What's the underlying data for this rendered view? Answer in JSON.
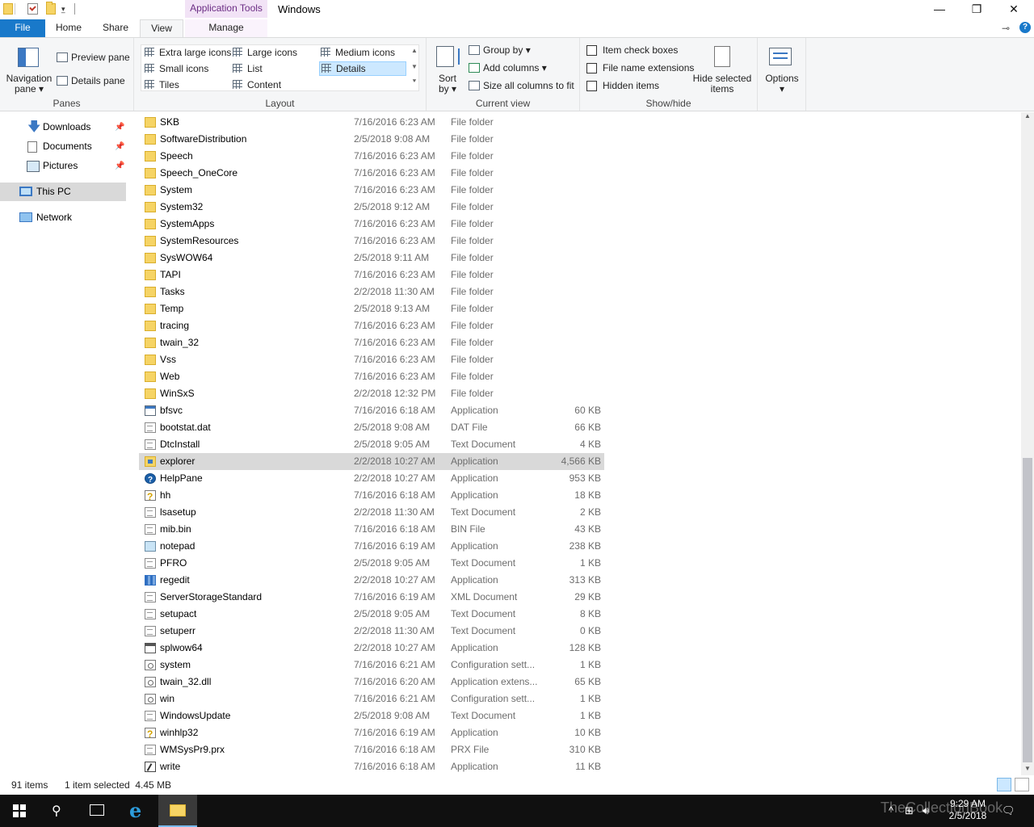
{
  "titlebar": {
    "contextual_tab": "Application Tools",
    "window_title": "Windows",
    "minimize": "—",
    "maximize": "❐",
    "close": "✕"
  },
  "ribbon_tabs": {
    "file": "File",
    "home": "Home",
    "share": "Share",
    "view": "View",
    "manage": "Manage"
  },
  "ribbon": {
    "panes": {
      "label": "Panes",
      "navigation_pane": "Navigation pane",
      "preview_pane": "Preview pane",
      "details_pane": "Details pane"
    },
    "layout": {
      "label": "Layout",
      "items": [
        "Extra large icons",
        "Large icons",
        "Medium icons",
        "Small icons",
        "List",
        "Details",
        "Tiles",
        "Content"
      ],
      "selected": "Details"
    },
    "current_view": {
      "label": "Current view",
      "sort_by": "Sort by",
      "group_by": "Group by",
      "add_columns": "Add columns",
      "size_columns": "Size all columns to fit"
    },
    "show_hide": {
      "label": "Show/hide",
      "item_check_boxes": "Item check boxes",
      "file_name_extensions": "File name extensions",
      "hidden_items": "Hidden items",
      "hide_selected": "Hide selected items"
    },
    "options": "Options"
  },
  "nav": {
    "items": [
      {
        "label": "Downloads",
        "pinned": true
      },
      {
        "label": "Documents",
        "pinned": true
      },
      {
        "label": "Pictures",
        "pinned": true
      },
      {
        "label": "This PC",
        "pinned": false
      },
      {
        "label": "Network",
        "pinned": false
      }
    ],
    "selected": "This PC"
  },
  "files": [
    {
      "name": "SKB",
      "date": "7/16/2016 6:23 AM",
      "type": "File folder",
      "size": "",
      "icon": "folder"
    },
    {
      "name": "SoftwareDistribution",
      "date": "2/5/2018 9:08 AM",
      "type": "File folder",
      "size": "",
      "icon": "folder"
    },
    {
      "name": "Speech",
      "date": "7/16/2016 6:23 AM",
      "type": "File folder",
      "size": "",
      "icon": "folder"
    },
    {
      "name": "Speech_OneCore",
      "date": "7/16/2016 6:23 AM",
      "type": "File folder",
      "size": "",
      "icon": "folder"
    },
    {
      "name": "System",
      "date": "7/16/2016 6:23 AM",
      "type": "File folder",
      "size": "",
      "icon": "folder"
    },
    {
      "name": "System32",
      "date": "2/5/2018 9:12 AM",
      "type": "File folder",
      "size": "",
      "icon": "folder"
    },
    {
      "name": "SystemApps",
      "date": "7/16/2016 6:23 AM",
      "type": "File folder",
      "size": "",
      "icon": "folder"
    },
    {
      "name": "SystemResources",
      "date": "7/16/2016 6:23 AM",
      "type": "File folder",
      "size": "",
      "icon": "folder"
    },
    {
      "name": "SysWOW64",
      "date": "2/5/2018 9:11 AM",
      "type": "File folder",
      "size": "",
      "icon": "folder"
    },
    {
      "name": "TAPI",
      "date": "7/16/2016 6:23 AM",
      "type": "File folder",
      "size": "",
      "icon": "folder"
    },
    {
      "name": "Tasks",
      "date": "2/2/2018 11:30 AM",
      "type": "File folder",
      "size": "",
      "icon": "folder"
    },
    {
      "name": "Temp",
      "date": "2/5/2018 9:13 AM",
      "type": "File folder",
      "size": "",
      "icon": "folder"
    },
    {
      "name": "tracing",
      "date": "7/16/2016 6:23 AM",
      "type": "File folder",
      "size": "",
      "icon": "folder"
    },
    {
      "name": "twain_32",
      "date": "7/16/2016 6:23 AM",
      "type": "File folder",
      "size": "",
      "icon": "folder"
    },
    {
      "name": "Vss",
      "date": "7/16/2016 6:23 AM",
      "type": "File folder",
      "size": "",
      "icon": "folder"
    },
    {
      "name": "Web",
      "date": "7/16/2016 6:23 AM",
      "type": "File folder",
      "size": "",
      "icon": "folder"
    },
    {
      "name": "WinSxS",
      "date": "2/2/2018 12:32 PM",
      "type": "File folder",
      "size": "",
      "icon": "folder"
    },
    {
      "name": "bfsvc",
      "date": "7/16/2016 6:18 AM",
      "type": "Application",
      "size": "60 KB",
      "icon": "app"
    },
    {
      "name": "bootstat.dat",
      "date": "2/5/2018 9:08 AM",
      "type": "DAT File",
      "size": "66 KB",
      "icon": "doc"
    },
    {
      "name": "DtcInstall",
      "date": "2/5/2018 9:05 AM",
      "type": "Text Document",
      "size": "4 KB",
      "icon": "doc"
    },
    {
      "name": "explorer",
      "date": "2/2/2018 10:27 AM",
      "type": "Application",
      "size": "4,566 KB",
      "icon": "explorer"
    },
    {
      "name": "HelpPane",
      "date": "2/2/2018 10:27 AM",
      "type": "Application",
      "size": "953 KB",
      "icon": "help"
    },
    {
      "name": "hh",
      "date": "7/16/2016 6:18 AM",
      "type": "Application",
      "size": "18 KB",
      "icon": "qhelp"
    },
    {
      "name": "lsasetup",
      "date": "2/2/2018 11:30 AM",
      "type": "Text Document",
      "size": "2 KB",
      "icon": "doc"
    },
    {
      "name": "mib.bin",
      "date": "7/16/2016 6:18 AM",
      "type": "BIN File",
      "size": "43 KB",
      "icon": "doc"
    },
    {
      "name": "notepad",
      "date": "7/16/2016 6:19 AM",
      "type": "Application",
      "size": "238 KB",
      "icon": "notepad"
    },
    {
      "name": "PFRO",
      "date": "2/5/2018 9:05 AM",
      "type": "Text Document",
      "size": "1 KB",
      "icon": "doc"
    },
    {
      "name": "regedit",
      "date": "2/2/2018 10:27 AM",
      "type": "Application",
      "size": "313 KB",
      "icon": "regedit"
    },
    {
      "name": "ServerStorageStandard",
      "date": "7/16/2016 6:19 AM",
      "type": "XML Document",
      "size": "29 KB",
      "icon": "doc"
    },
    {
      "name": "setupact",
      "date": "2/5/2018 9:05 AM",
      "type": "Text Document",
      "size": "8 KB",
      "icon": "doc"
    },
    {
      "name": "setuperr",
      "date": "2/2/2018 11:30 AM",
      "type": "Text Document",
      "size": "0 KB",
      "icon": "doc"
    },
    {
      "name": "splwow64",
      "date": "2/2/2018 10:27 AM",
      "type": "Application",
      "size": "128 KB",
      "icon": "printer"
    },
    {
      "name": "system",
      "date": "7/16/2016 6:21 AM",
      "type": "Configuration sett...",
      "size": "1 KB",
      "icon": "gear"
    },
    {
      "name": "twain_32.dll",
      "date": "7/16/2016 6:20 AM",
      "type": "Application extens...",
      "size": "65 KB",
      "icon": "gear"
    },
    {
      "name": "win",
      "date": "7/16/2016 6:21 AM",
      "type": "Configuration sett...",
      "size": "1 KB",
      "icon": "gear"
    },
    {
      "name": "WindowsUpdate",
      "date": "2/5/2018 9:08 AM",
      "type": "Text Document",
      "size": "1 KB",
      "icon": "doc"
    },
    {
      "name": "winhlp32",
      "date": "7/16/2016 6:19 AM",
      "type": "Application",
      "size": "10 KB",
      "icon": "qhelp"
    },
    {
      "name": "WMSysPr9.prx",
      "date": "7/16/2016 6:18 AM",
      "type": "PRX File",
      "size": "310 KB",
      "icon": "doc"
    },
    {
      "name": "write",
      "date": "7/16/2016 6:18 AM",
      "type": "Application",
      "size": "11 KB",
      "icon": "write"
    }
  ],
  "selected_file": "explorer",
  "status": {
    "item_count": "91 items",
    "selection": "1 item selected  4.45 MB"
  },
  "taskbar": {
    "time": "9:29 AM",
    "date": "2/5/2018",
    "watermark": "TheCollectionBook"
  },
  "colors": {
    "accent": "#1979ca",
    "contextual_tab_bg": "#f2e3f6",
    "selection": "#d9d9d9",
    "folder": "#f6d465"
  }
}
